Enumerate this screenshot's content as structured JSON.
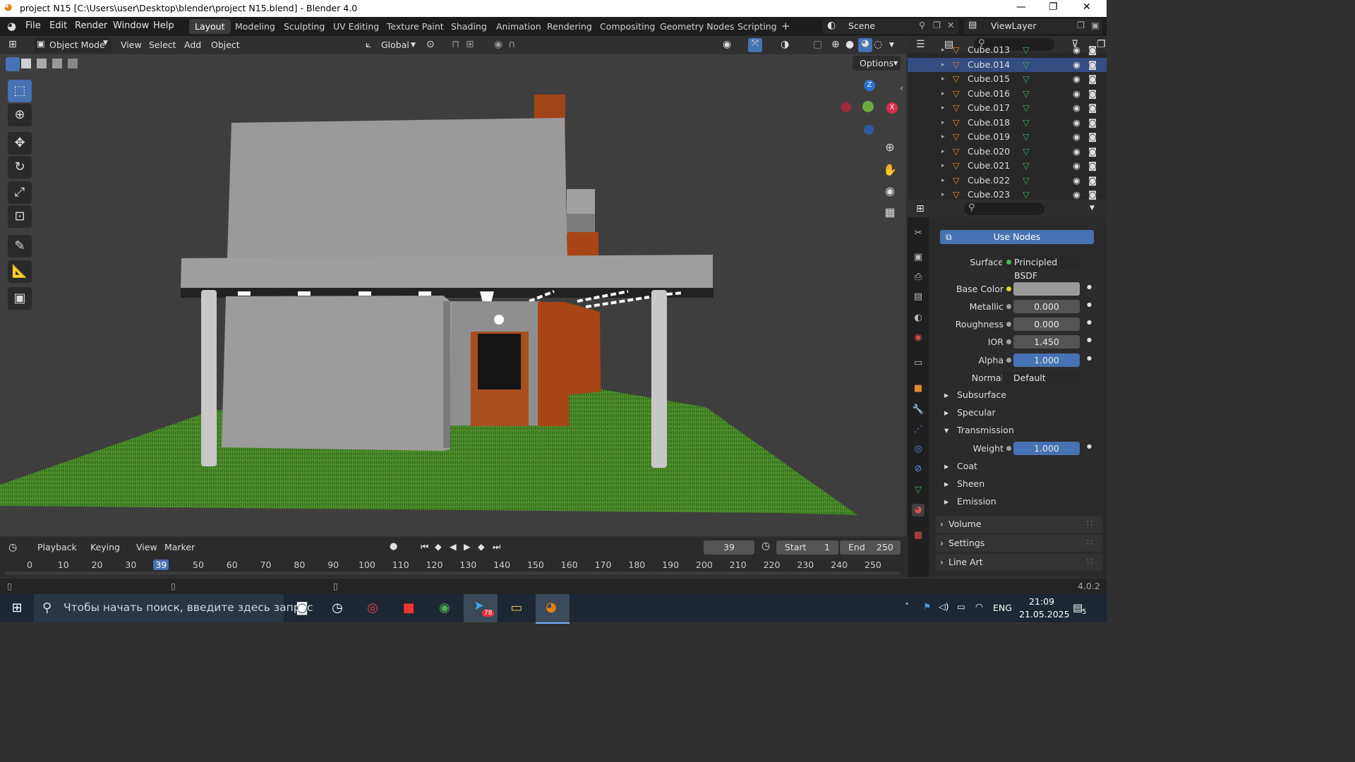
{
  "window": {
    "title": "project N15 [C:\\Users\\user\\Desktop\\blender\\project N15.blend] - Blender 4.0",
    "minimize": "—",
    "maximize": "❐",
    "close": "✕"
  },
  "menu": [
    "File",
    "Edit",
    "Render",
    "Window",
    "Help"
  ],
  "workspaces": [
    "Layout",
    "Modeling",
    "Sculpting",
    "UV Editing",
    "Texture Paint",
    "Shading",
    "Animation",
    "Rendering",
    "Compositing",
    "Geometry Nodes",
    "Scripting"
  ],
  "workspace_add": "+",
  "scene": {
    "label": "Scene",
    "view_layer": "ViewLayer"
  },
  "viewport_header": {
    "mode": "Object Mode",
    "view": "View",
    "select": "Select",
    "add": "Add",
    "object": "Object",
    "transform": "Global",
    "options": "Options"
  },
  "gizmo": {
    "z": "Z",
    "x": "X"
  },
  "outliner": {
    "rows": [
      {
        "name": "Cube.013",
        "selected": false
      },
      {
        "name": "Cube.014",
        "selected": true
      },
      {
        "name": "Cube.015",
        "selected": false
      },
      {
        "name": "Cube.016",
        "selected": false
      },
      {
        "name": "Cube.017",
        "selected": false
      },
      {
        "name": "Cube.018",
        "selected": false
      },
      {
        "name": "Cube.019",
        "selected": false
      },
      {
        "name": "Cube.020",
        "selected": false
      },
      {
        "name": "Cube.021",
        "selected": false
      },
      {
        "name": "Cube.022",
        "selected": false
      },
      {
        "name": "Cube.023",
        "selected": false
      }
    ]
  },
  "properties": {
    "use_nodes": "Use Nodes",
    "surface_label": "Surface",
    "surface_value": "Principled BSDF",
    "fields": [
      {
        "label": "Base Color",
        "value": "",
        "style": "color"
      },
      {
        "label": "Metallic",
        "value": "0.000",
        "style": "normal"
      },
      {
        "label": "Roughness",
        "value": "0.000",
        "style": "normal"
      },
      {
        "label": "IOR",
        "value": "1.450",
        "style": "normal"
      },
      {
        "label": "Alpha",
        "value": "1.000",
        "style": "blue"
      },
      {
        "label": "Normal",
        "value": "Default",
        "style": "dark"
      }
    ],
    "subsections": [
      "Subsurface",
      "Specular",
      "Transmission"
    ],
    "weight_label": "Weight",
    "weight_value": "1.000",
    "more_sections": [
      "Coat",
      "Sheen",
      "Emission"
    ],
    "panels": [
      "Volume",
      "Settings",
      "Line Art"
    ]
  },
  "timeline": {
    "playback": "Playback",
    "keying": "Keying",
    "view": "View",
    "marker": "Marker",
    "current_frame": "39",
    "start_label": "Start",
    "start": "1",
    "end_label": "End",
    "end": "250",
    "ticks": [
      "0",
      "10",
      "20",
      "30",
      "39",
      "50",
      "60",
      "70",
      "80",
      "90",
      "100",
      "110",
      "120",
      "130",
      "140",
      "150",
      "160",
      "170",
      "180",
      "190",
      "200",
      "210",
      "220",
      "230",
      "240",
      "250"
    ]
  },
  "status": {
    "version": "4.0.2"
  },
  "taskbar": {
    "search_placeholder": "Чтобы начать поиск, введите здесь запрос",
    "lang": "ENG",
    "time": "21:09",
    "date": "21.05.2025",
    "notifications": "5",
    "telegram_badge": "78"
  }
}
